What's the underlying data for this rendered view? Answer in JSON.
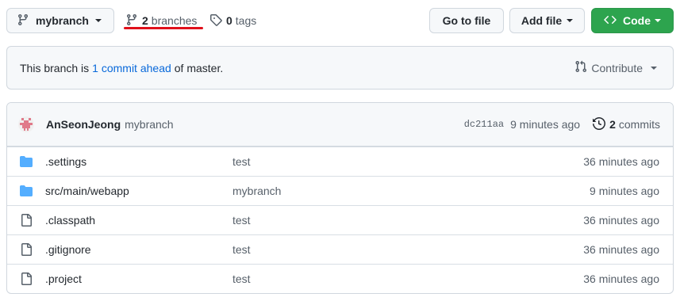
{
  "toolbar": {
    "branch_label": "mybranch",
    "branches_count": "2",
    "branches_label": "branches",
    "tags_count": "0",
    "tags_label": "tags",
    "go_to_file": "Go to file",
    "add_file": "Add file",
    "code": "Code"
  },
  "ahead": {
    "prefix": "This branch is",
    "link": "1 commit ahead",
    "suffix": "of master.",
    "contribute": "Contribute"
  },
  "commit": {
    "author": "AnSeonJeong",
    "message": "mybranch",
    "sha": "dc211aa",
    "time": "9 minutes ago",
    "commits_count": "2",
    "commits_label": "commits"
  },
  "files": [
    {
      "icon": "folder-icon",
      "name": ".settings",
      "message": "test",
      "age": "36 minutes ago"
    },
    {
      "icon": "folder-icon",
      "name": "src/main/webapp",
      "message": "mybranch",
      "age": "9 minutes ago"
    },
    {
      "icon": "file-icon",
      "name": ".classpath",
      "message": "test",
      "age": "36 minutes ago"
    },
    {
      "icon": "file-icon",
      "name": ".gitignore",
      "message": "test",
      "age": "36 minutes ago"
    },
    {
      "icon": "file-icon",
      "name": ".project",
      "message": "test",
      "age": "36 minutes ago"
    }
  ],
  "colors": {
    "accent_link": "#0969da",
    "code_button": "#2da44e",
    "folder": "#54aeff",
    "highlight": "#e0101b"
  }
}
